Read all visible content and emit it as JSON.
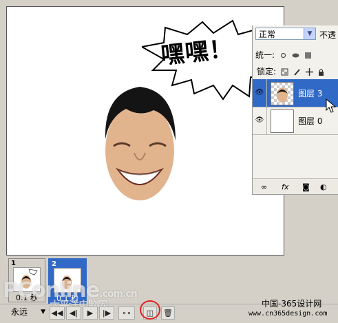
{
  "canvas": {
    "speech_text": "嘿嘿！"
  },
  "layers_panel": {
    "blend_mode": "正常",
    "opacity_label": "不透",
    "unify_label": "统一:",
    "lock_label": "锁定:",
    "layers": [
      {
        "name": "图层 3",
        "selected": true,
        "visible": true
      },
      {
        "name": "图层 0",
        "selected": false,
        "visible": true
      }
    ],
    "bottom_icons": [
      "link-icon",
      "fx-icon",
      "mask-icon",
      "adjustment-icon"
    ]
  },
  "animation": {
    "frames": [
      {
        "number": "1",
        "delay": "0.1 秒",
        "selected": false
      },
      {
        "number": "2",
        "delay": "0.1 秒",
        "selected": true
      }
    ],
    "loop": "永远",
    "buttons": [
      "first-frame",
      "prev-frame",
      "play",
      "next-frame",
      "tween",
      "duplicate-frame",
      "delete-frame"
    ]
  },
  "watermark": {
    "main": "PConline",
    "suffix": ".com.cn",
    "sub": "太平洋电脑网"
  },
  "credits": {
    "cn": "中国-365设计网",
    "url": "www.cn365design.com"
  }
}
